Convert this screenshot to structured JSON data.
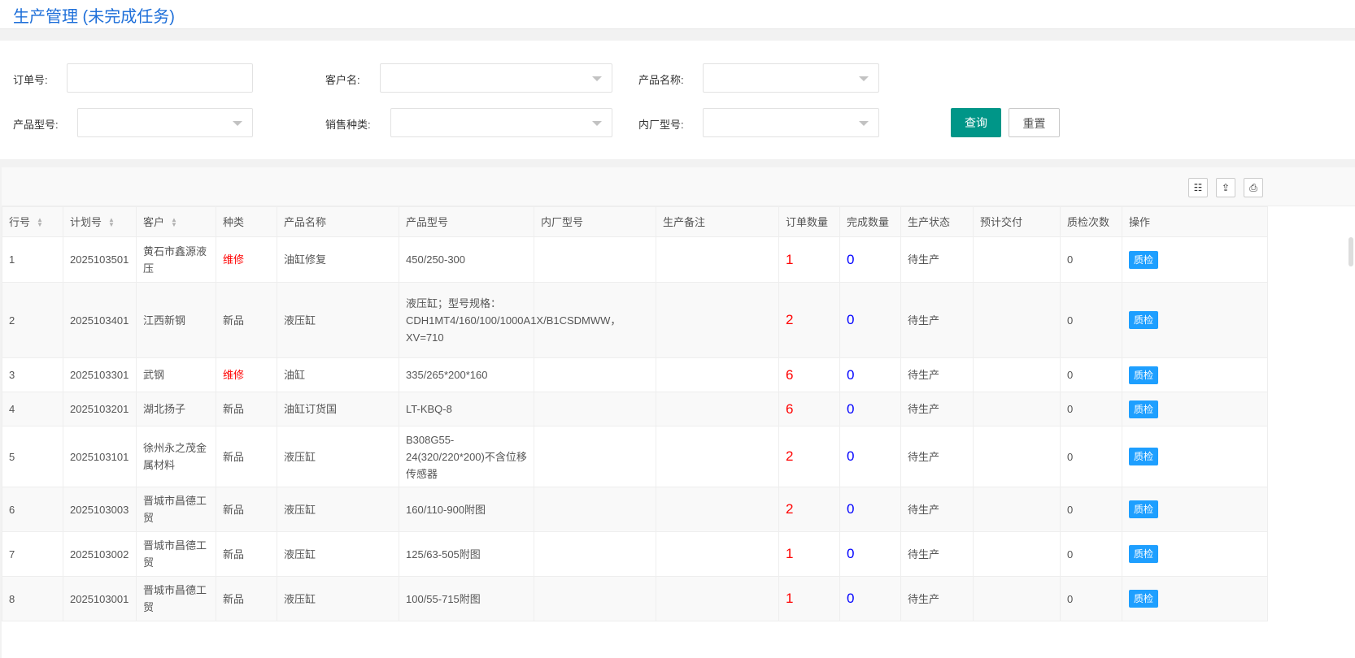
{
  "title": "生产管理 (未完成任务)",
  "filters": {
    "order_no": "订单号:",
    "customer": "客户名:",
    "product_name": "产品名称:",
    "product_model": "产品型号:",
    "sales_type": "销售种类:",
    "factory_model": "内厂型号:",
    "query": "查询",
    "reset": "重置"
  },
  "toolbar": {
    "columns": "☷",
    "export": "⇪",
    "print": "⎙"
  },
  "columns": [
    "行号",
    "计划号",
    "客户",
    "种类",
    "产品名称",
    "产品型号",
    "内厂型号",
    "生产备注",
    "订单数量",
    "完成数量",
    "生产状态",
    "预计交付",
    "质检次数",
    "操作"
  ],
  "rows": [
    {
      "no": "1",
      "plan": "2025103501",
      "customer": "黄石市鑫源液压",
      "type": "维修",
      "name": "油缸修复",
      "model": "450/250-300",
      "factory": "",
      "remark": "",
      "qty": "1",
      "done": "0",
      "status": "待生产",
      "delivery": "",
      "qc_count": "0",
      "action": "质检"
    },
    {
      "no": "2",
      "plan": "2025103401",
      "customer": "江西新钢",
      "type": "新品",
      "name": "液压缸",
      "model": "液压缸；型号规格：CDH1MT4/160/100/1000A1X/B1CSDMWW，XV=710",
      "factory": "",
      "remark": "",
      "qty": "2",
      "done": "0",
      "status": "待生产",
      "delivery": "",
      "qc_count": "0",
      "action": "质检"
    },
    {
      "no": "3",
      "plan": "2025103301",
      "customer": "武钢",
      "type": "维修",
      "name": "油缸",
      "model": "335/265*200*160",
      "factory": "",
      "remark": "",
      "qty": "6",
      "done": "0",
      "status": "待生产",
      "delivery": "",
      "qc_count": "0",
      "action": "质检"
    },
    {
      "no": "4",
      "plan": "2025103201",
      "customer": "湖北扬子",
      "type": "新品",
      "name": "油缸订货国",
      "model": "LT-KBQ-8",
      "factory": "",
      "remark": "",
      "qty": "6",
      "done": "0",
      "status": "待生产",
      "delivery": "",
      "qc_count": "0",
      "action": "质检"
    },
    {
      "no": "5",
      "plan": "2025103101",
      "customer": "徐州永之茂金属材料",
      "type": "新品",
      "name": "液压缸",
      "model": "B308G55-24(320/220*200)不含位移传感器",
      "factory": "",
      "remark": "",
      "qty": "2",
      "done": "0",
      "status": "待生产",
      "delivery": "",
      "qc_count": "0",
      "action": "质检"
    },
    {
      "no": "6",
      "plan": "2025103003",
      "customer": "晋城市昌德工贸",
      "type": "新品",
      "name": "液压缸",
      "model": "160/110-900附图",
      "factory": "",
      "remark": "",
      "qty": "2",
      "done": "0",
      "status": "待生产",
      "delivery": "",
      "qc_count": "0",
      "action": "质检"
    },
    {
      "no": "7",
      "plan": "2025103002",
      "customer": "晋城市昌德工贸",
      "type": "新品",
      "name": "液压缸",
      "model": "125/63-505附图",
      "factory": "",
      "remark": "",
      "qty": "1",
      "done": "0",
      "status": "待生产",
      "delivery": "",
      "qc_count": "0",
      "action": "质检"
    },
    {
      "no": "8",
      "plan": "2025103001",
      "customer": "晋城市昌德工贸",
      "type": "新品",
      "name": "液压缸",
      "model": "100/55-715附图",
      "factory": "",
      "remark": "",
      "qty": "1",
      "done": "0",
      "status": "待生产",
      "delivery": "",
      "qc_count": "0",
      "action": "质检"
    }
  ]
}
